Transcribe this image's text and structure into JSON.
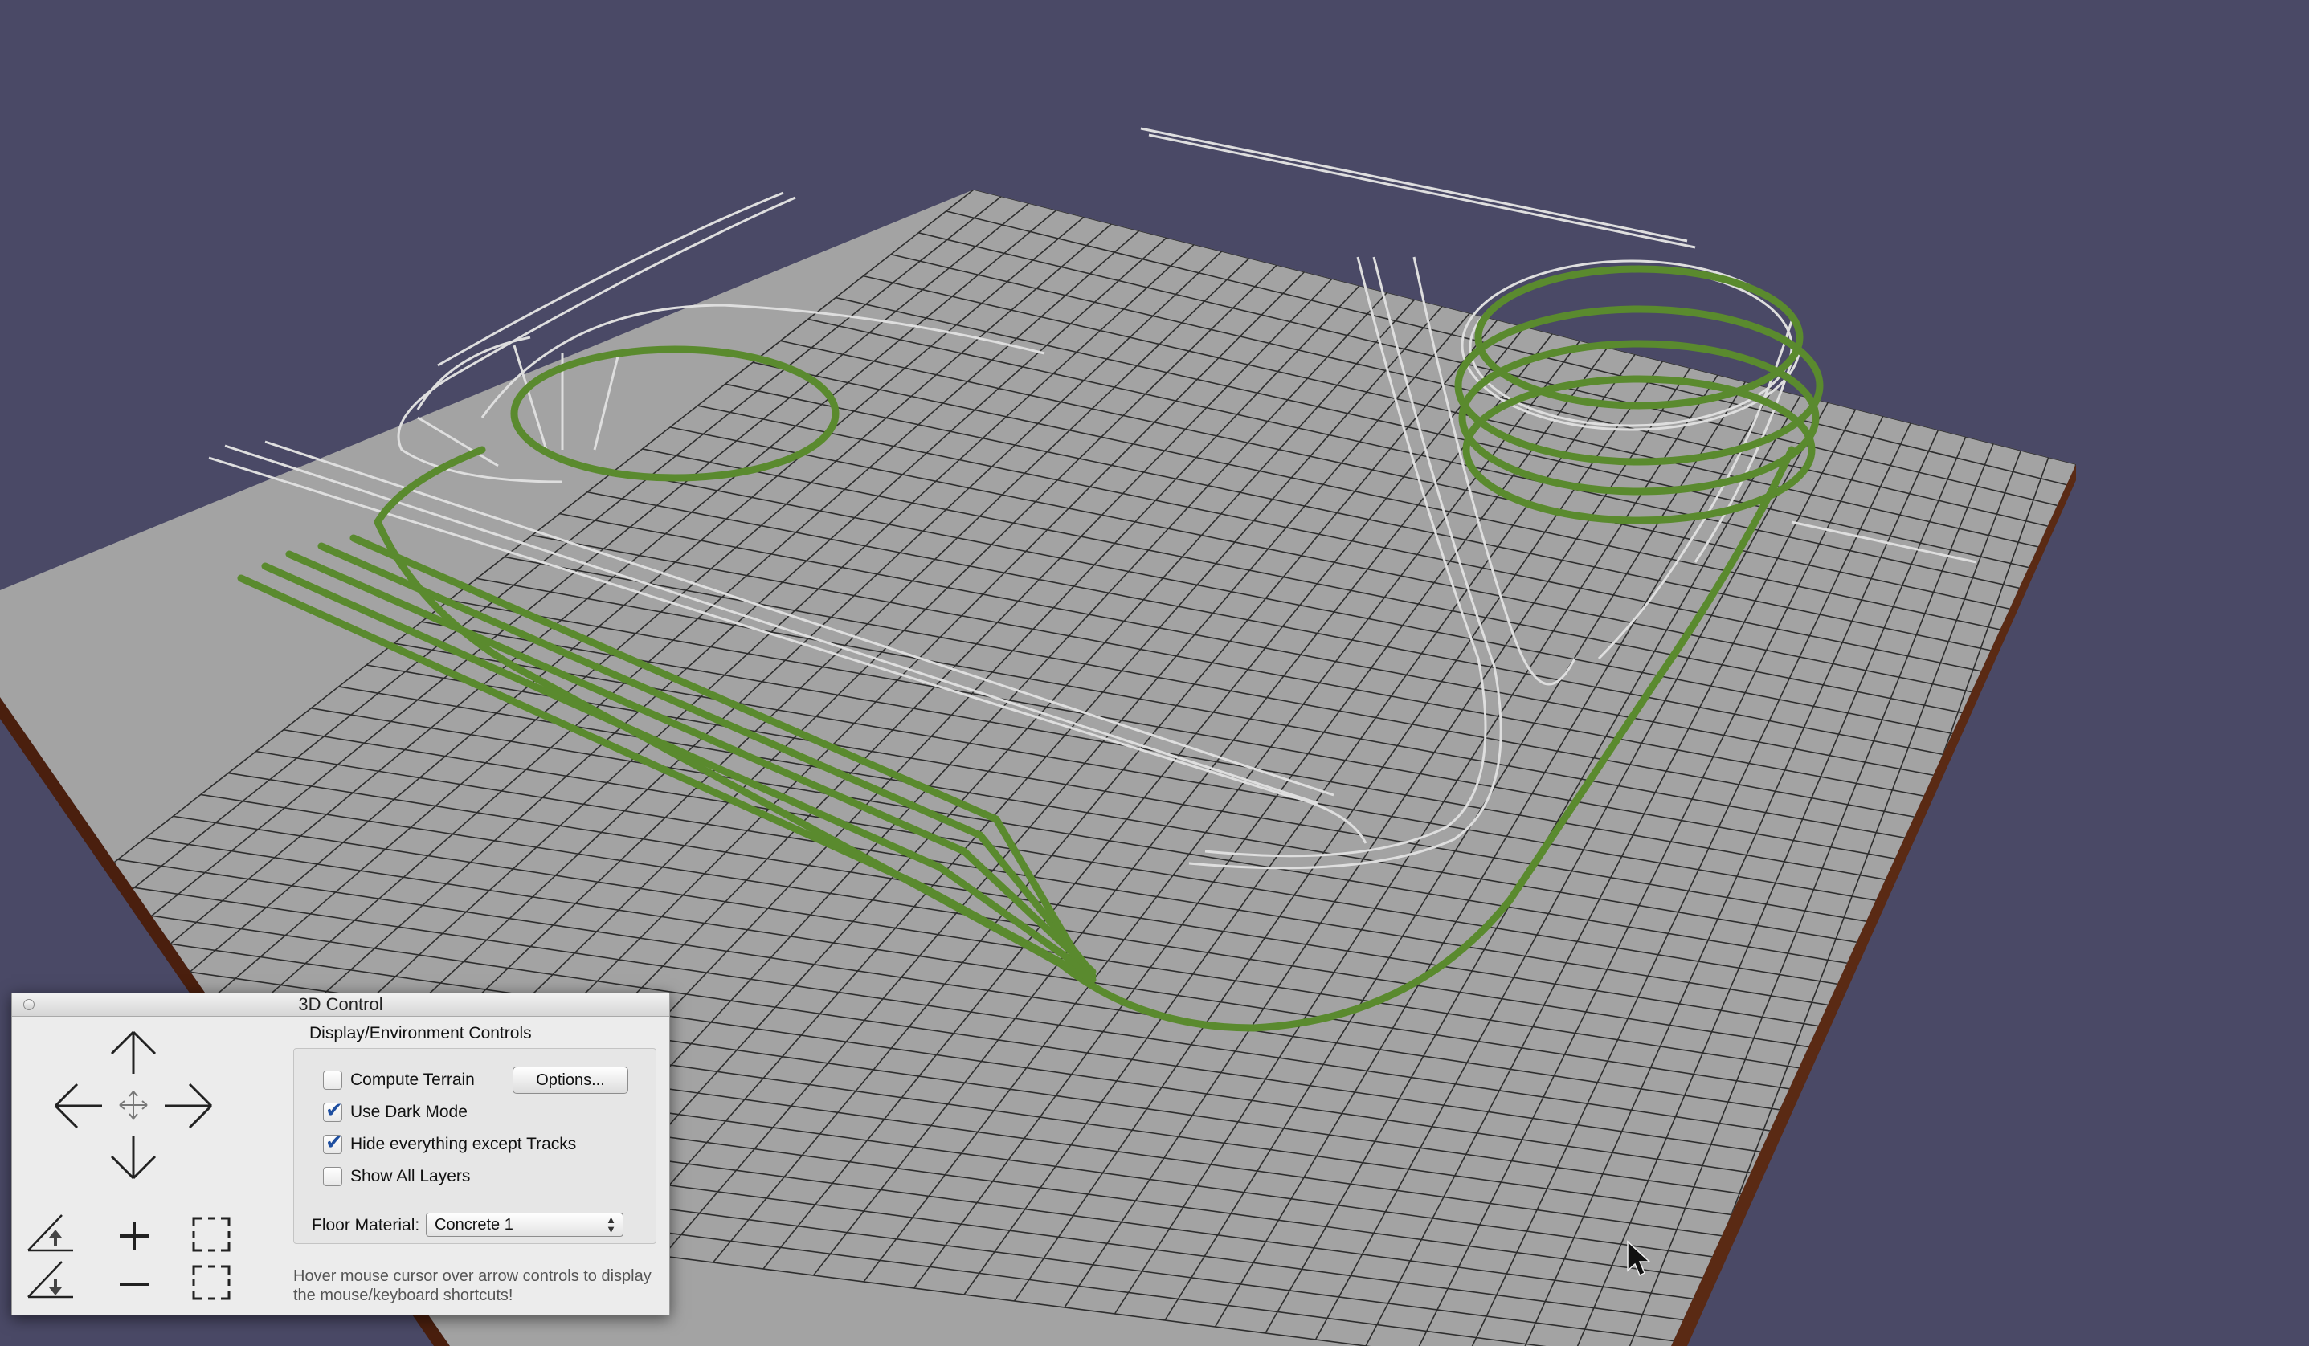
{
  "viewport": {
    "background_color": "#4a4966",
    "floor_color": "#a3a3a3",
    "grid_color": "#2e2e2e",
    "edge_color": "#5a2a14",
    "track_color": "#5a8a2e",
    "inactive_track_color": "#dedede"
  },
  "panel": {
    "title": "3D Control",
    "group_title": "Display/Environment Controls",
    "checkboxes": [
      {
        "label": "Compute Terrain",
        "checked": false
      },
      {
        "label": "Use Dark Mode",
        "checked": true
      },
      {
        "label": "Hide everything except Tracks",
        "checked": true
      },
      {
        "label": "Show All Layers",
        "checked": false
      }
    ],
    "options_button": "Options...",
    "floor_material_label": "Floor Material:",
    "floor_material_value": "Concrete 1",
    "hint": "Hover mouse cursor over arrow controls to display the mouse/keyboard shortcuts!"
  }
}
